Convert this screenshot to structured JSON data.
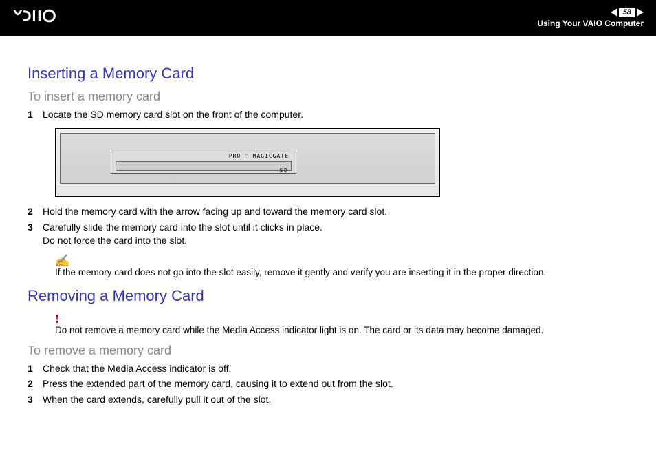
{
  "header": {
    "page_number": "58",
    "section": "Using Your VAIO Computer"
  },
  "sections": [
    {
      "title": "Inserting a Memory Card",
      "subtitle": "To insert a memory card",
      "steps": [
        {
          "n": "1",
          "text": "Locate the SD memory card slot on the front of the computer."
        },
        {
          "n": "2",
          "text": "Hold the memory card with the arrow facing up and toward the memory card slot."
        },
        {
          "n": "3",
          "text": "Carefully slide the memory card into the slot until it clicks in place.\nDo not force the card into the slot."
        }
      ],
      "illustration": {
        "label_top": "PRO  ⬚  MAGICGATE",
        "label_bottom": "SD"
      },
      "note": "If the memory card does not go into the slot easily, remove it gently and verify you are inserting it in the proper direction."
    },
    {
      "title": "Removing a Memory Card",
      "warning": "Do not remove a memory card while the Media Access indicator light is on. The card or its data may become damaged.",
      "subtitle": "To remove a memory card",
      "steps": [
        {
          "n": "1",
          "text": "Check that the Media Access indicator is off."
        },
        {
          "n": "2",
          "text": "Press the extended part of the memory card, causing it to extend out from the slot."
        },
        {
          "n": "3",
          "text": "When the card extends, carefully pull it out of the slot."
        }
      ]
    }
  ]
}
